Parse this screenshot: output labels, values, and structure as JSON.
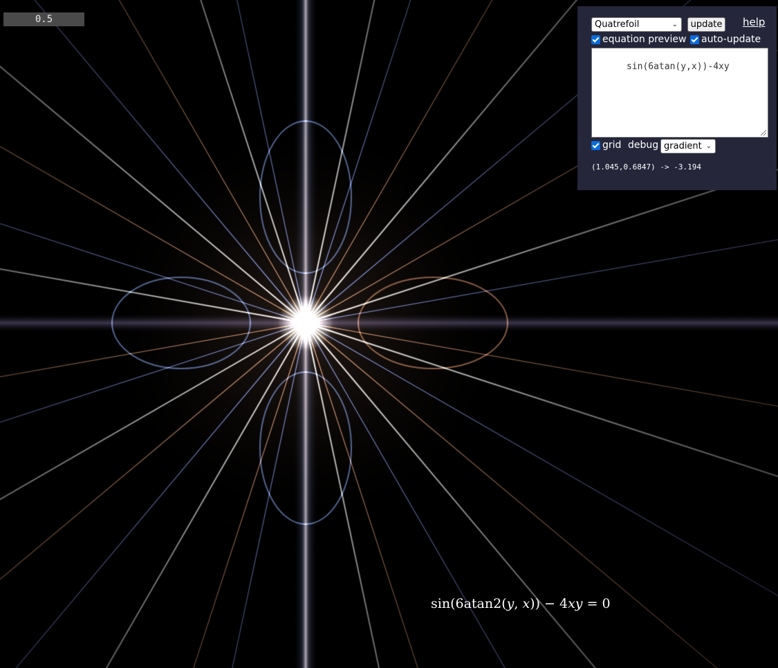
{
  "readout": {
    "value": "0.5"
  },
  "panel": {
    "preset": {
      "selected": "Quatrefoil"
    },
    "update_label": "update",
    "help_label": "help",
    "equation_preview": {
      "label": "equation preview",
      "checked": true
    },
    "auto_update": {
      "label": "auto-update",
      "checked": true
    },
    "equation_text": "sin(6atan(y,x))-4xy",
    "grid": {
      "label": "grid",
      "checked": true
    },
    "debug_label": "debug",
    "mode": {
      "selected": "gradient"
    },
    "coord_readout": "(1.045,0.6847) -> -3.194"
  },
  "equation_render": {
    "parts": [
      "sin",
      "(6atan2",
      "(",
      "y",
      ", ",
      "x",
      "))",
      " − 4",
      "xy",
      " = 0"
    ]
  },
  "colors": {
    "panel_bg": "#25263a",
    "background": "#000000",
    "warm_glow": "#f0a070",
    "cool_glow": "#8fb0ff",
    "checkbox_accent": "#0a6ce0"
  },
  "icons": {
    "dropdown": "chevron-down-icon",
    "checkbox": "checkmark-icon",
    "resize": "resize-grip-icon"
  }
}
